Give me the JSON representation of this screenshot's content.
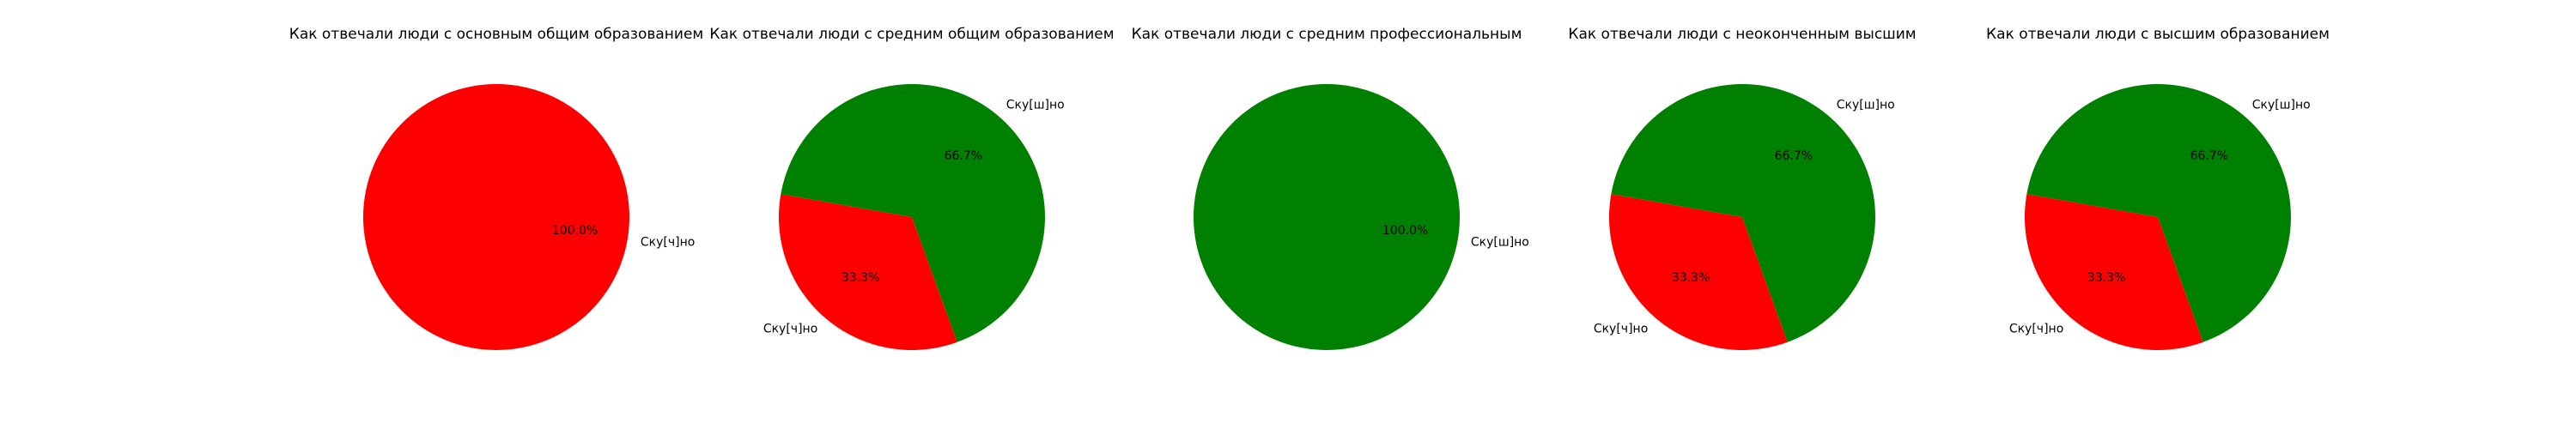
{
  "chart_data": [
    {
      "type": "pie",
      "title": "Как отвечали люди с основным общим образованием",
      "slices": [
        {
          "label": "Ску[ч]но",
          "value": 100.0,
          "pct_label": "100.0%",
          "color": "#ff0000"
        }
      ]
    },
    {
      "type": "pie",
      "title": "Как отвечали люди с средним общим образованием",
      "slices": [
        {
          "label": "Ску[ч]но",
          "value": 33.3,
          "pct_label": "33.3%",
          "color": "#ff0000"
        },
        {
          "label": "Ску[ш]но",
          "value": 66.7,
          "pct_label": "66.7%",
          "color": "#008000"
        }
      ]
    },
    {
      "type": "pie",
      "title": "Как отвечали люди с средним профессиональным",
      "slices": [
        {
          "label": "Ску[ш]но",
          "value": 100.0,
          "pct_label": "100.0%",
          "color": "#008000"
        }
      ]
    },
    {
      "type": "pie",
      "title": "Как отвечали люди с неоконченным высшим",
      "slices": [
        {
          "label": "Ску[ч]но",
          "value": 33.3,
          "pct_label": "33.3%",
          "color": "#ff0000"
        },
        {
          "label": "Ску[ш]но",
          "value": 66.7,
          "pct_label": "66.7%",
          "color": "#008000"
        }
      ]
    },
    {
      "type": "pie",
      "title": "Как отвечали люди с высшим образованием",
      "slices": [
        {
          "label": "Ску[ч]но",
          "value": 33.3,
          "pct_label": "33.3%",
          "color": "#ff0000"
        },
        {
          "label": "Ску[ш]но",
          "value": 66.7,
          "pct_label": "66.7%",
          "color": "#008000"
        }
      ]
    }
  ]
}
